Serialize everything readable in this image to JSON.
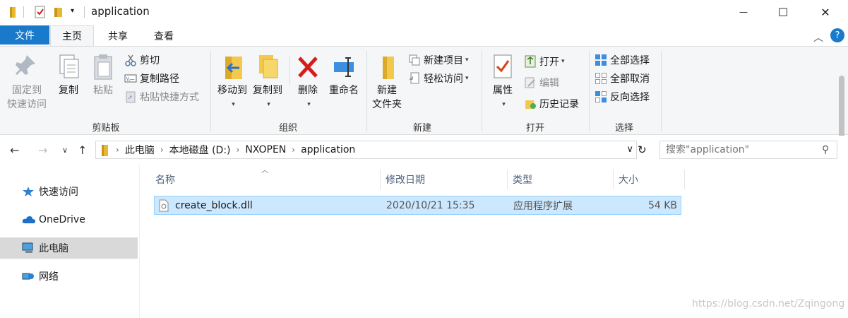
{
  "window": {
    "title": "application",
    "minimize_glyph": "—",
    "maximize_glyph": "☐",
    "close_glyph": "✕"
  },
  "tabs": {
    "file": "文件",
    "home": "主页",
    "share": "共享",
    "view": "查看"
  },
  "ribbon": {
    "clipboard": {
      "group_label": "剪贴板",
      "pin": "固定到\n快速访问",
      "pin_line1": "固定到",
      "pin_line2": "快速访问",
      "copy": "复制",
      "paste": "粘贴",
      "cut": "剪切",
      "copy_path": "复制路径",
      "paste_shortcut": "粘贴快捷方式"
    },
    "organize": {
      "group_label": "组织",
      "move_to": "移动到",
      "copy_to": "复制到",
      "delete": "删除",
      "rename": "重命名"
    },
    "new": {
      "group_label": "新建",
      "new_folder_line1": "新建",
      "new_folder_line2": "文件夹",
      "new_item": "新建项目",
      "easy_access": "轻松访问"
    },
    "open": {
      "group_label": "打开",
      "properties": "属性",
      "open": "打开",
      "edit": "编辑",
      "history": "历史记录"
    },
    "select": {
      "group_label": "选择",
      "select_all": "全部选择",
      "select_none": "全部取消",
      "invert": "反向选择"
    }
  },
  "address": {
    "crumbs": [
      "此电脑",
      "本地磁盘 (D:)",
      "NXOPEN",
      "application"
    ],
    "search_placeholder": "搜索\"application\""
  },
  "nav_pane": [
    {
      "label": "快速访问",
      "icon": "star-icon"
    },
    {
      "label": "OneDrive",
      "icon": "cloud-icon"
    },
    {
      "label": "此电脑",
      "icon": "computer-icon",
      "selected": true
    },
    {
      "label": "网络",
      "icon": "network-icon"
    }
  ],
  "columns": {
    "name": "名称",
    "modified": "修改日期",
    "type": "类型",
    "size": "大小"
  },
  "files": [
    {
      "name": "create_block.dll",
      "modified": "2020/10/21 15:35",
      "type": "应用程序扩展",
      "size": "54 KB"
    }
  ],
  "watermark": "https://blog.csdn.net/Zqingong",
  "colors": {
    "accent": "#1979ca",
    "selection_bg": "#cce8ff",
    "selection_border": "#99d1ff",
    "folder": "#e8b830"
  }
}
